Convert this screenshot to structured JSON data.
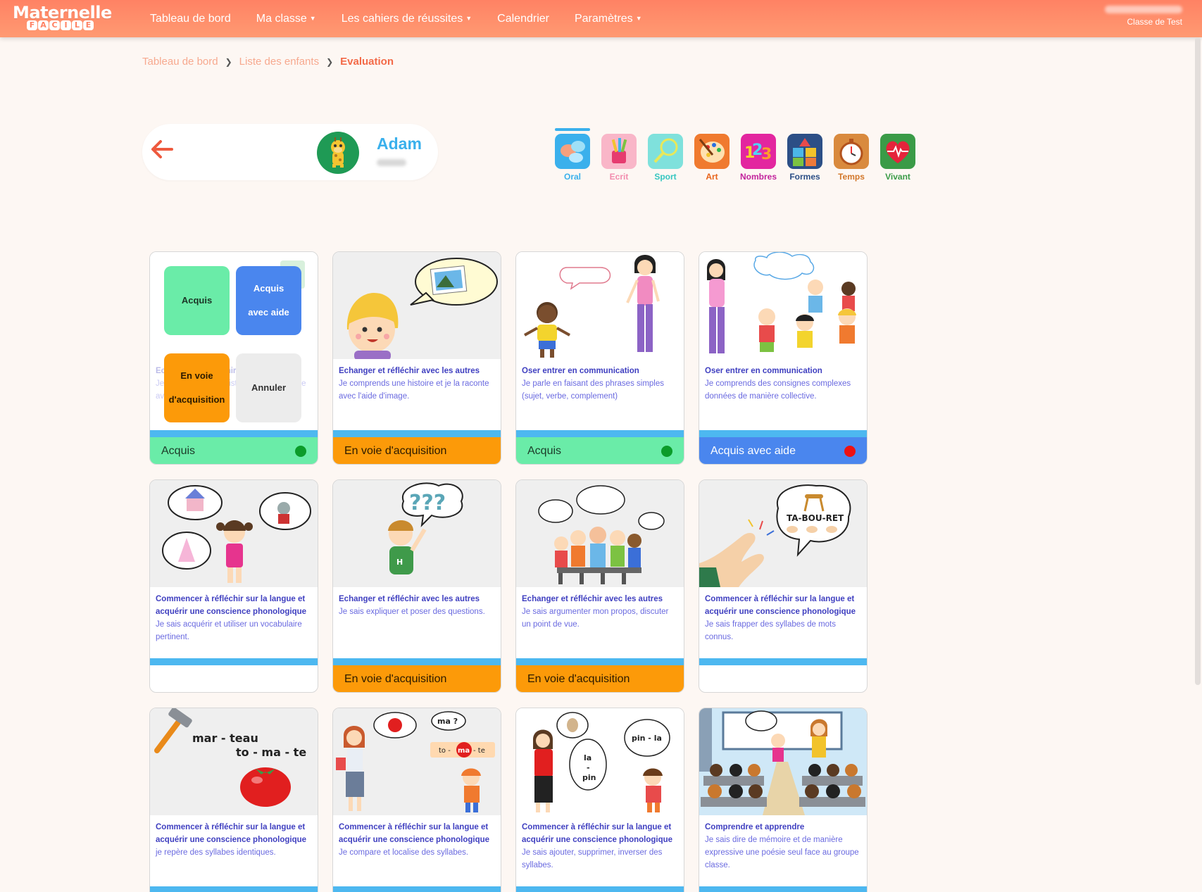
{
  "app": {
    "logo_top": "Maternelle",
    "logo_bottom": [
      "F",
      "A",
      "C",
      "I",
      "L",
      "E"
    ]
  },
  "nav": [
    {
      "label": "Tableau de bord",
      "dropdown": false
    },
    {
      "label": "Ma classe",
      "dropdown": true
    },
    {
      "label": "Les cahiers de réussites",
      "dropdown": true
    },
    {
      "label": "Calendrier",
      "dropdown": false
    },
    {
      "label": "Paramètres",
      "dropdown": true
    }
  ],
  "user": {
    "class_name": "Classe de Test"
  },
  "breadcrumb": {
    "items": [
      "Tableau de bord",
      "Liste des enfants"
    ],
    "current": "Evaluation"
  },
  "child": {
    "name": "Adam"
  },
  "domains": [
    {
      "label": "Oral",
      "color": "#3ab0ec",
      "active": true
    },
    {
      "label": "Ecrit",
      "color": "#f28cae",
      "active": false
    },
    {
      "label": "Sport",
      "color": "#35c6c0",
      "active": false
    },
    {
      "label": "Art",
      "color": "#e8641b",
      "active": false
    },
    {
      "label": "Nombres",
      "color": "#c2239c",
      "active": false
    },
    {
      "label": "Formes",
      "color": "#2c4f86",
      "active": false
    },
    {
      "label": "Temps",
      "color": "#d2772a",
      "active": false
    },
    {
      "label": "Vivant",
      "color": "#3a9b47",
      "active": false
    }
  ],
  "popup": {
    "acquis": "Acquis",
    "aide_line1": "Acquis",
    "aide_line2": "avec aide",
    "voie_line1": "En voie",
    "voie_line2": "d'acquisition",
    "annuler": "Annuler"
  },
  "cards": [
    {
      "category": "Echanger et réfléchir avec les autres",
      "description": "Je comprends une histoire et je la raconte avec l'aide d'image.",
      "status": "Acquis",
      "status_type": "acquis",
      "dot_color": "#0b9c2a"
    },
    {
      "category": "Echanger et réfléchir avec les autres",
      "description": "Je comprends une histoire et je la raconte avec l'aide d'image.",
      "status": "En voie d'acquisition",
      "status_type": "envoie",
      "dot_color": ""
    },
    {
      "category": "Oser entrer en communication",
      "description": "Je parle en faisant des phrases simples (sujet, verbe, complement)",
      "status": "Acquis",
      "status_type": "acquis",
      "dot_color": "#0b9c2a"
    },
    {
      "category": "Oser entrer en communication",
      "description": "Je comprends des consignes complexes données de manière collective.",
      "status": "Acquis avec aide",
      "status_type": "aide",
      "dot_color": "#ee1111"
    },
    {
      "category": "Commencer à réfléchir sur la langue et acquérir une conscience phonologique",
      "description": "Je sais acquérir et utiliser un vocabulaire pertinent.",
      "status": "",
      "status_type": "none",
      "dot_color": ""
    },
    {
      "category": "Echanger et réfléchir avec les autres",
      "description": "Je sais expliquer et poser des questions.",
      "status": "En voie d'acquisition",
      "status_type": "envoie",
      "dot_color": ""
    },
    {
      "category": "Echanger et réfléchir avec les autres",
      "description": "Je sais argumenter mon propos, discuter un point de vue.",
      "status": "En voie d'acquisition",
      "status_type": "envoie",
      "dot_color": ""
    },
    {
      "category": "Commencer à réfléchir sur la langue et acquérir une conscience phonologique",
      "description": "Je sais frapper des syllabes de mots connus.",
      "status": "",
      "status_type": "none",
      "dot_color": ""
    },
    {
      "category": "Commencer à réfléchir sur la langue et acquérir une conscience phonologique",
      "description": "je repère des syllabes identiques.",
      "status": "",
      "status_type": "none",
      "dot_color": ""
    },
    {
      "category": "Commencer à réfléchir sur la langue et acquérir une conscience phonologique",
      "description": "Je compare et localise des syllabes.",
      "status": "",
      "status_type": "none",
      "dot_color": ""
    },
    {
      "category": "Commencer à réfléchir sur la langue et acquérir une conscience phonologique",
      "description": "Je sais ajouter, supprimer, inverser des syllabes.",
      "status": "",
      "status_type": "none",
      "dot_color": ""
    },
    {
      "category": "Comprendre et apprendre",
      "description": "Je sais dire de mémoire et de manière expressive une poésie seul face au groupe classe.",
      "status": "",
      "status_type": "none",
      "dot_color": ""
    }
  ],
  "illustration_text": {
    "tabouret": "TA-BOU-RET",
    "marteau": "mar - teau",
    "tomate": "to - ma - te",
    "ma_q": "ma ?",
    "tomate2a": "to -",
    "tomate2b": "ma",
    "tomate2c": "- te",
    "lapin_la": "la",
    "lapin_dash": "-",
    "lapin_pin": "pin",
    "pin_la": "pin - la",
    "questions": "???",
    "h_letter": "H"
  }
}
